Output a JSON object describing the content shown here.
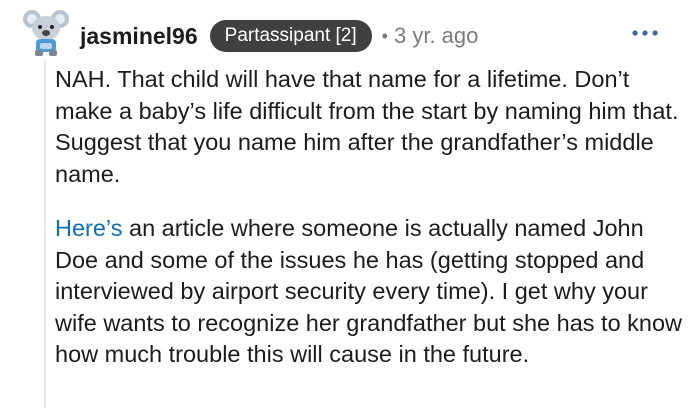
{
  "comment": {
    "avatar_icon": "koala-avatar-icon",
    "username": "jasminel96",
    "badge": "Partassipant [2]",
    "separator": "•",
    "timestamp": "3 yr. ago",
    "more_icon": "more-horizontal-icon",
    "paragraph1": "NAH. That child will have that name for a lifetime. Don’t make a baby’s life difficult from the start by naming him that. Suggest that you name him after the grandfather’s middle name.",
    "link_text": "Here’s",
    "paragraph2_rest": " an article where someone is actually named John Doe and some of the issues he has (getting stopped and interviewed by airport security every time). I get why your wife wants to recognize her grandfather but she has to know how much trouble this will cause in the future."
  },
  "colors": {
    "link": "#0a6fb7",
    "badge_bg": "#404040",
    "meta_text": "#7c7c7c",
    "more_icon": "#3b6aa0"
  }
}
